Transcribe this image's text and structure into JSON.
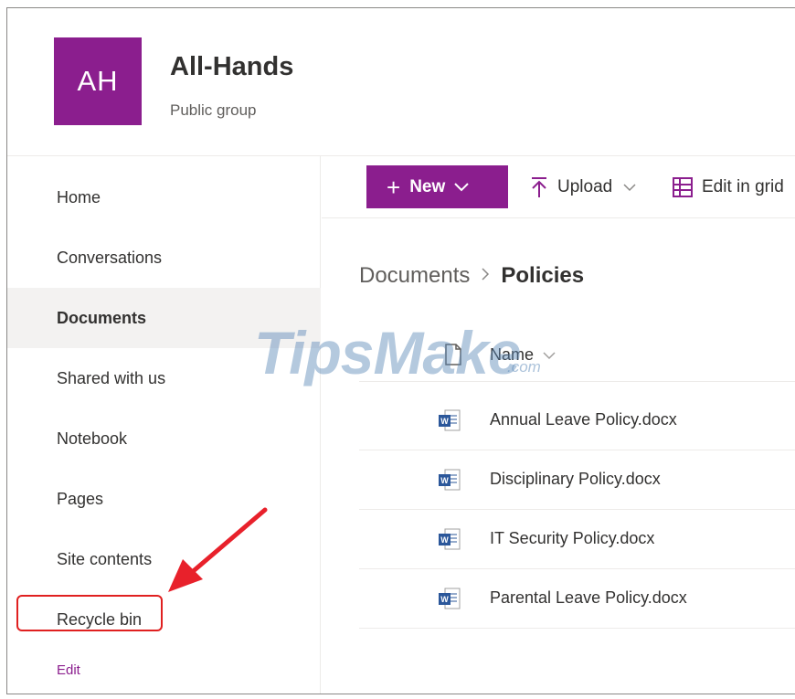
{
  "site": {
    "logo_initials": "AH",
    "title": "All-Hands",
    "subtitle": "Public group",
    "accent_color": "#8b1e8e"
  },
  "nav": {
    "items": [
      {
        "label": "Home"
      },
      {
        "label": "Conversations"
      },
      {
        "label": "Documents",
        "selected": true
      },
      {
        "label": "Shared with us"
      },
      {
        "label": "Notebook"
      },
      {
        "label": "Pages"
      },
      {
        "label": "Site contents"
      },
      {
        "label": "Recycle bin",
        "highlighted": true
      }
    ],
    "edit_label": "Edit"
  },
  "command_bar": {
    "new_label": "New",
    "upload_label": "Upload",
    "edit_grid_label": "Edit in grid"
  },
  "breadcrumb": {
    "root": "Documents",
    "current": "Policies"
  },
  "file_list": {
    "name_column": "Name",
    "files": [
      {
        "name": "Annual Leave Policy.docx",
        "icon": "word-doc-icon"
      },
      {
        "name": "Disciplinary Policy.docx",
        "icon": "word-doc-icon"
      },
      {
        "name": "IT Security Policy.docx",
        "icon": "word-doc-icon"
      },
      {
        "name": "Parental Leave Policy.docx",
        "icon": "word-doc-icon"
      }
    ]
  },
  "watermark": {
    "text": "TipsMake",
    "suffix": ".com"
  }
}
